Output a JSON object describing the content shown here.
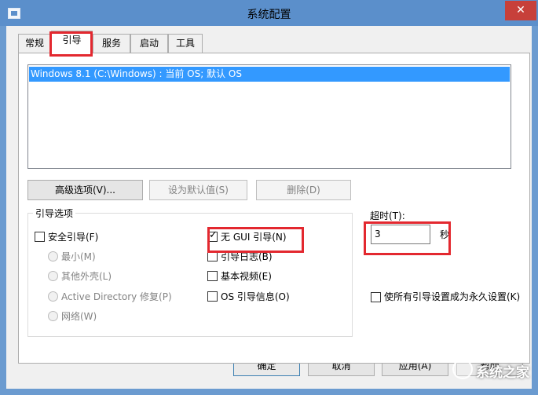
{
  "window": {
    "title": "系统配置",
    "close_glyph": "✕"
  },
  "tabs": [
    "常规",
    "引导",
    "服务",
    "启动",
    "工具"
  ],
  "os_list": {
    "items": [
      "Windows 8.1 (C:\\Windows) : 当前 OS; 默认 OS"
    ]
  },
  "buttons": {
    "advanced": "高级选项(V)...",
    "set_default": "设为默认值(S)",
    "delete": "删除(D)",
    "ok": "确定",
    "cancel": "取消",
    "apply": "应用(A)",
    "help": "帮助"
  },
  "boot_options": {
    "title": "引导选项",
    "safe_boot": {
      "label": "安全引导(F)",
      "checked": false
    },
    "radios": [
      "最小(M)",
      "其他外壳(L)",
      "Active Directory 修复(P)",
      "网络(W)"
    ],
    "no_gui": {
      "label": "无 GUI 引导(N)",
      "checked": true
    },
    "boot_log": {
      "label": "引导日志(B)",
      "checked": false
    },
    "base_video": {
      "label": "基本视频(E)",
      "checked": false
    },
    "os_info": {
      "label": "OS 引导信息(O)",
      "checked": false
    }
  },
  "timeout": {
    "label": "超时(T):",
    "value": "3",
    "unit": "秒"
  },
  "permanent": {
    "label": "使所有引导设置成为永久设置(K)",
    "checked": false
  },
  "watermark": {
    "text": "系统之家"
  },
  "colors": {
    "titlebar": "#5b8fcb",
    "selection": "#3399ff",
    "highlight_box": "#e3282f"
  }
}
